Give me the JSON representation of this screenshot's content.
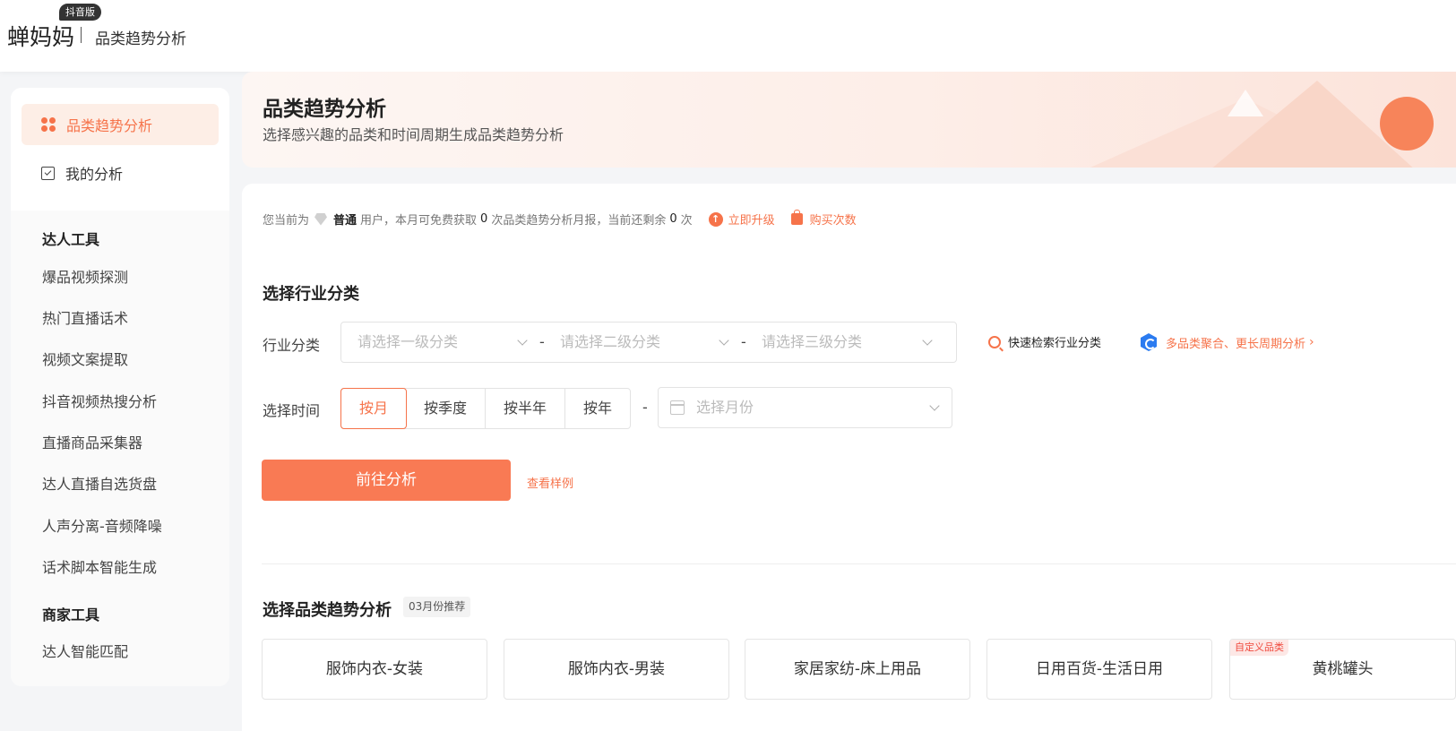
{
  "header": {
    "logo": "蝉妈妈",
    "badge": "抖音版",
    "subtitle": "品类趋势分析"
  },
  "sidebar": {
    "main_items": [
      {
        "label": "品类趋势分析",
        "icon": "grid-dots-icon",
        "active": true
      },
      {
        "label": "我的分析",
        "icon": "checkbox-icon",
        "active": false
      }
    ],
    "groups": [
      {
        "title": "达人工具",
        "items": [
          "爆品视频探测",
          "热门直播话术",
          "视频文案提取",
          "抖音视频热搜分析",
          "直播商品采集器",
          "达人直播自选货盘",
          "人声分离-音频降噪",
          "话术脚本智能生成"
        ]
      },
      {
        "title": "商家工具",
        "items": [
          "达人智能匹配"
        ]
      }
    ]
  },
  "banner": {
    "title": "品类趋势分析",
    "subtitle": "选择感兴趣的品类和时间周期生成品类趋势分析"
  },
  "notice": {
    "prefix": "您当前为",
    "level": "普通",
    "text1": "用户，本月可免费获取",
    "free_count": "0",
    "text2": "次品类趋势分析月报，当前还剩余",
    "remaining": "0",
    "text3": "次",
    "upgrade_label": "立即升级",
    "buy_label": "购买次数"
  },
  "industry": {
    "section_title": "选择行业分类",
    "label": "行业分类",
    "level1_placeholder": "请选择一级分类",
    "level2_placeholder": "请选择二级分类",
    "level3_placeholder": "请选择三级分类",
    "separator": "-",
    "quick_search_label": "快速检索行业分类",
    "multi_label": "多品类聚合、更长周期分析"
  },
  "time": {
    "label": "选择时间",
    "options": [
      "按月",
      "按季度",
      "按半年",
      "按年"
    ],
    "selected": "按月",
    "separator": "-",
    "month_placeholder": "选择月份"
  },
  "actions": {
    "go_label": "前往分析",
    "sample_label": "查看样例"
  },
  "recommend": {
    "section_title": "选择品类趋势分析",
    "tag": "03月份推荐",
    "cards": [
      {
        "label": "服饰内衣-女装",
        "tag": ""
      },
      {
        "label": "服饰内衣-男装",
        "tag": ""
      },
      {
        "label": "家居家纺-床上用品",
        "tag": ""
      },
      {
        "label": "日用百货-生活日用",
        "tag": ""
      },
      {
        "label": "黄桃罐头",
        "tag": "自定义品类"
      }
    ]
  },
  "colors": {
    "accent": "#f6734a",
    "button": "#f97a54",
    "active_bg": "#fdeee6"
  }
}
